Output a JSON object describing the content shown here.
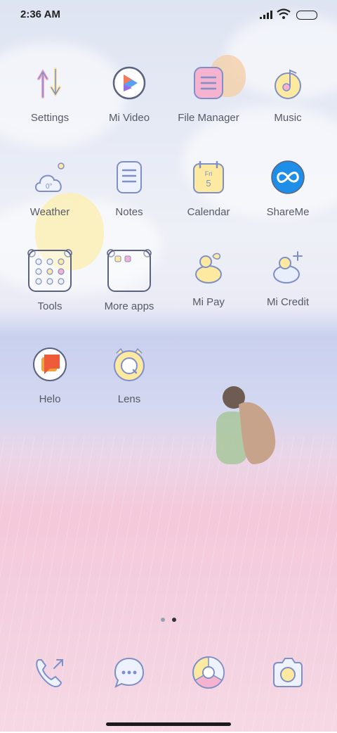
{
  "status_bar": {
    "time": "2:36 AM"
  },
  "apps": [
    {
      "label": "Settings",
      "icon": "settings-icon"
    },
    {
      "label": "Mi Video",
      "icon": "mi-video-icon"
    },
    {
      "label": "File Manager",
      "icon": "file-manager-icon"
    },
    {
      "label": "Music",
      "icon": "music-icon"
    },
    {
      "label": "Weather",
      "icon": "weather-icon",
      "icon_text": "0°"
    },
    {
      "label": "Notes",
      "icon": "notes-icon"
    },
    {
      "label": "Calendar",
      "icon": "calendar-icon",
      "icon_text": "Fri",
      "icon_number": "5"
    },
    {
      "label": "ShareMe",
      "icon": "shareme-icon"
    },
    {
      "label": "Tools",
      "icon": "tools-folder-icon"
    },
    {
      "label": "More apps",
      "icon": "more-apps-folder-icon"
    },
    {
      "label": "Mi Pay",
      "icon": "mi-pay-icon"
    },
    {
      "label": "Mi Credit",
      "icon": "mi-credit-icon"
    },
    {
      "label": "Helo",
      "icon": "helo-icon"
    },
    {
      "label": "Lens",
      "icon": "lens-icon"
    }
  ],
  "dock": [
    {
      "icon": "phone-icon"
    },
    {
      "icon": "messages-icon"
    },
    {
      "icon": "browser-icon"
    },
    {
      "icon": "camera-icon"
    }
  ],
  "page_indicator": {
    "pages": 2,
    "current": 2
  },
  "colors": {
    "label": "#555a66",
    "icon_stroke": "#7f8fc7",
    "icon_fill_yellow": "#fde9a0",
    "icon_fill_pink": "#f5b3cf"
  }
}
